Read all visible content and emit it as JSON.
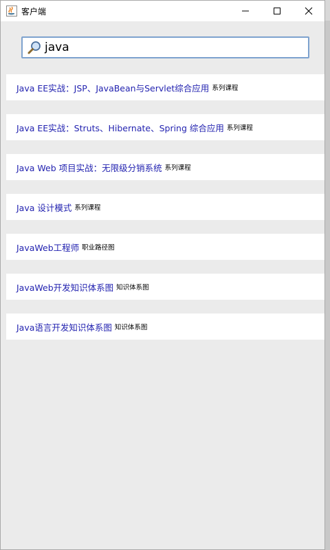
{
  "window": {
    "title": "客户端"
  },
  "search": {
    "value": "java"
  },
  "results": [
    {
      "title": "Java EE实战：JSP、JavaBean与Servlet综合应用",
      "tag": "系列课程"
    },
    {
      "title": "Java EE实战：Struts、Hibernate、Spring 综合应用",
      "tag": "系列课程"
    },
    {
      "title": "Java Web 项目实战：无限级分销系统",
      "tag": "系列课程"
    },
    {
      "title": "Java 设计模式",
      "tag": "系列课程"
    },
    {
      "title": "JavaWeb工程师",
      "tag": "职业路径图"
    },
    {
      "title": "JavaWeb开发知识体系图",
      "tag": "知识体系图"
    },
    {
      "title": "Java语言开发知识体系图",
      "tag": "知识体系图"
    }
  ],
  "colors": {
    "link": "#2323b0",
    "search_border": "#7da2ce",
    "panel_bg": "#ebebeb"
  },
  "icons": {
    "app": "java-cup-icon",
    "search": "magnifier-icon",
    "minimize": "minimize-icon",
    "maximize": "maximize-icon",
    "close": "close-icon"
  }
}
